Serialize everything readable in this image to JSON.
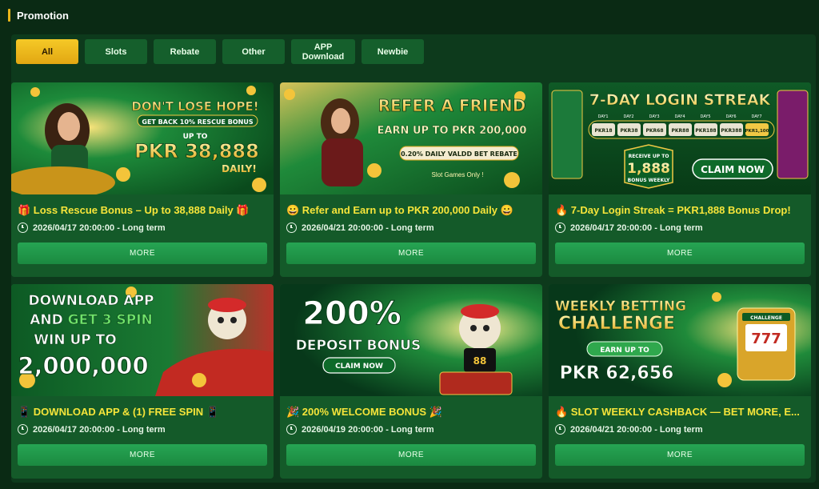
{
  "page": {
    "title": "Promotion"
  },
  "tabs": [
    {
      "label": "All",
      "active": true
    },
    {
      "label": "Slots"
    },
    {
      "label": "Rebate"
    },
    {
      "label": "Other"
    },
    {
      "label": "APP\nDownload"
    },
    {
      "label": "Newbie"
    }
  ],
  "more_label": "MORE",
  "cards": [
    {
      "title": "🎁 Loss Rescue Bonus – Up to 38,888 Daily 🎁",
      "date": "2026/04/17 20:00:00 - Long term",
      "banner": {
        "line1": "DON'T LOSE HOPE!",
        "line2": "GET BACK 10% RESCUE BONUS",
        "line3": "UP TO",
        "line4": "PKR 38,888",
        "line5": "DAILY!"
      }
    },
    {
      "title": "😀 Refer and Earn up to PKR 200,000 Daily 😀",
      "date": "2026/04/21 20:00:00 - Long term",
      "banner": {
        "line1": "REFER A FRIEND",
        "line2": "EARN UP TO PKR 200,000",
        "line3": "0.20% DAILY VALDD BET REBATE",
        "line4": "Slot Games Only !"
      }
    },
    {
      "title": "🔥 7-Day Login Streak = PKR1,888 Bonus Drop!",
      "date": "2026/04/17 20:00:00 - Long term",
      "banner": {
        "line1": "7-DAY LOGIN STREAK",
        "days": [
          "DAY1",
          "DAY2",
          "DAY3",
          "DAY4",
          "DAY5",
          "DAY6",
          "DAY7"
        ],
        "amounts": [
          "PKR18",
          "PKR38",
          "PKR68",
          "PKR88",
          "PKR188",
          "PKR388",
          "PKR1,100"
        ],
        "receive": "RECEIVE UP TO",
        "big": "1,888",
        "weekly": "BONUS WEEKLY",
        "claim": "CLAIM NOW"
      }
    },
    {
      "title": "📱 DOWNLOAD APP & (1) FREE SPIN 📱",
      "date": "2026/04/17 20:00:00 - Long term",
      "banner": {
        "line1": "DOWNLOAD APP",
        "line2a": "AND ",
        "line2b": "GET 3 SPIN",
        "line3": "WIN UP TO",
        "line4": "2,000,000"
      }
    },
    {
      "title": "🎉 200% WELCOME BONUS 🎉",
      "date": "2026/04/19 20:00:00 - Long term",
      "banner": {
        "line1": "200%",
        "line2": "DEPOSIT BONUS",
        "claim": "CLAIM NOW"
      }
    },
    {
      "title": "🔥 SLOT WEEKLY CASHBACK — BET MORE, E...",
      "date": "2026/04/21 20:00:00 - Long term",
      "banner": {
        "line1": "WEEKLY BETTING",
        "line2": "CHALLENGE",
        "line3": "EARN UP TO",
        "line4": "PKR 62,656",
        "tag": "CHALLENGE"
      }
    }
  ]
}
